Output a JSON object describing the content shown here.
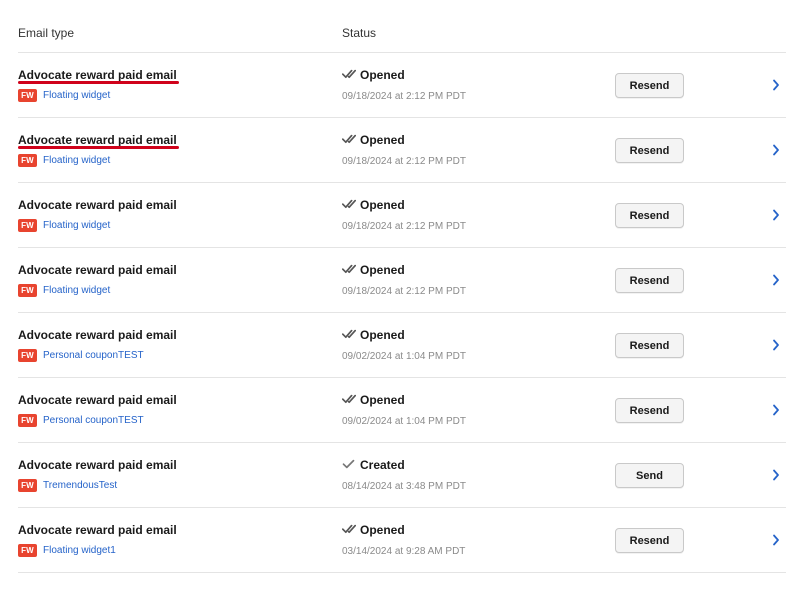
{
  "header": {
    "email_type": "Email type",
    "status": "Status"
  },
  "colors": {
    "link": "#2563c9",
    "badge": "#e8442f",
    "underline_marker": "#d0021b"
  },
  "rows": [
    {
      "title": "Advocate reward paid email",
      "badge": "FW",
      "widget": "Floating widget",
      "status": "Opened",
      "status_icon": "double-check-icon",
      "date": "09/18/2024 at 2:12 PM PDT",
      "action": "Resend",
      "underlined": true
    },
    {
      "title": "Advocate reward paid email",
      "badge": "FW",
      "widget": "Floating widget",
      "status": "Opened",
      "status_icon": "double-check-icon",
      "date": "09/18/2024 at 2:12 PM PDT",
      "action": "Resend",
      "underlined": true
    },
    {
      "title": "Advocate reward paid email",
      "badge": "FW",
      "widget": "Floating widget",
      "status": "Opened",
      "status_icon": "double-check-icon",
      "date": "09/18/2024 at 2:12 PM PDT",
      "action": "Resend",
      "underlined": false
    },
    {
      "title": "Advocate reward paid email",
      "badge": "FW",
      "widget": "Floating widget",
      "status": "Opened",
      "status_icon": "double-check-icon",
      "date": "09/18/2024 at 2:12 PM PDT",
      "action": "Resend",
      "underlined": false
    },
    {
      "title": "Advocate reward paid email",
      "badge": "FW",
      "widget": "Personal couponTEST",
      "status": "Opened",
      "status_icon": "double-check-icon",
      "date": "09/02/2024 at 1:04 PM PDT",
      "action": "Resend",
      "underlined": false
    },
    {
      "title": "Advocate reward paid email",
      "badge": "FW",
      "widget": "Personal couponTEST",
      "status": "Opened",
      "status_icon": "double-check-icon",
      "date": "09/02/2024 at 1:04 PM PDT",
      "action": "Resend",
      "underlined": false
    },
    {
      "title": "Advocate reward paid email",
      "badge": "FW",
      "widget": "TremendousTest",
      "status": "Created",
      "status_icon": "check-icon",
      "date": "08/14/2024 at 3:48 PM PDT",
      "action": "Send",
      "underlined": false
    },
    {
      "title": "Advocate reward paid email",
      "badge": "FW",
      "widget": "Floating widget1",
      "status": "Opened",
      "status_icon": "double-check-icon",
      "date": "03/14/2024 at 9:28 AM PDT",
      "action": "Resend",
      "underlined": false
    }
  ]
}
